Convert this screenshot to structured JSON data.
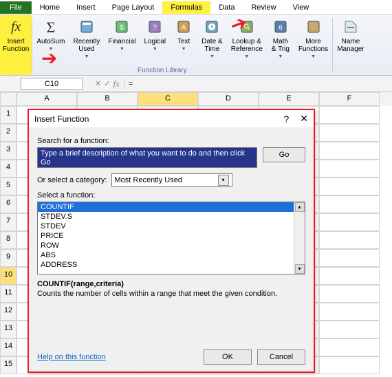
{
  "tabs": {
    "file": "File",
    "home": "Home",
    "insert": "Insert",
    "pageLayout": "Page Layout",
    "formulas": "Formulas",
    "data": "Data",
    "review": "Review",
    "view": "View"
  },
  "ribbon": {
    "insertFn": "Insert\nFunction",
    "autosum": "AutoSum",
    "recently": "Recently\nUsed",
    "financial": "Financial",
    "logical": "Logical",
    "text": "Text",
    "datetime": "Date &\nTime",
    "lookup": "Lookup &\nReference",
    "math": "Math\n& Trig",
    "more": "More\nFunctions",
    "name": "Name\nManager",
    "libLabel": "Function Library"
  },
  "namebox": "C10",
  "fxIcons": {
    "cancel": "✕",
    "enter": "✓",
    "fx": "fx"
  },
  "formulaBar": "=",
  "columns": [
    "A",
    "B",
    "C",
    "D",
    "E",
    "F"
  ],
  "rows": [
    "1",
    "2",
    "3",
    "4",
    "5",
    "6",
    "7",
    "8",
    "9",
    "10",
    "11",
    "12",
    "13",
    "14",
    "15"
  ],
  "dialog": {
    "title": "Insert Function",
    "help": "?",
    "close": "✕",
    "searchLabel": "Search for a function:",
    "searchText": "Type a brief description of what you want to do and then click Go",
    "go": "Go",
    "categoryLabel": "Or select a category:",
    "categoryValue": "Most Recently Used",
    "selectLabel": "Select a function:",
    "functions": [
      "COUNTIF",
      "STDEV.S",
      "STDEV",
      "PRICE",
      "ROW",
      "ABS",
      "ADDRESS"
    ],
    "syntax": "COUNTIF(range,criteria)",
    "desc": "Counts the number of cells within a range that meet the given condition.",
    "helpLink": "Help on this function",
    "ok": "OK",
    "cancel": "Cancel"
  }
}
